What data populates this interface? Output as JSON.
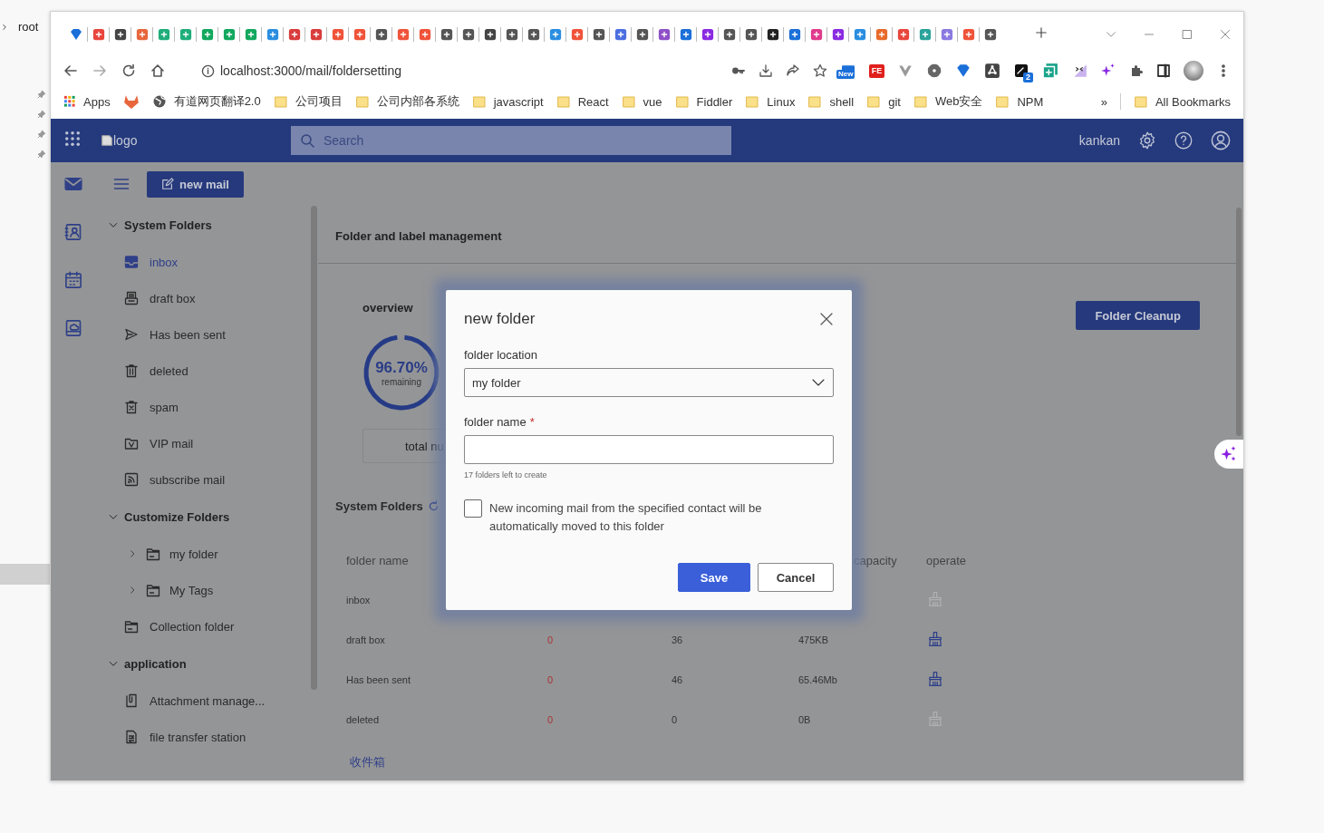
{
  "desktop": {
    "breadcrumb": "root"
  },
  "browser": {
    "url": "localhost:3000/mail/foldersetting",
    "extensions": [
      {
        "kind": "new",
        "label": "New"
      },
      {
        "kind": "fe",
        "label": "FE"
      },
      {
        "kind": "vee"
      },
      {
        "kind": "gear"
      },
      {
        "kind": "diamond"
      },
      {
        "kind": "graph"
      },
      {
        "kind": "translate",
        "label": "2"
      },
      {
        "kind": "copy"
      },
      {
        "kind": "code"
      },
      {
        "kind": "sparkle"
      }
    ],
    "bookmarks": [
      {
        "kind": "apps",
        "label": "Apps"
      },
      {
        "kind": "gitlab"
      },
      {
        "kind": "globe",
        "label": "有道网页翻译2.0"
      },
      {
        "kind": "folder",
        "label": "公司项目"
      },
      {
        "kind": "folder",
        "label": "公司内部各系统"
      },
      {
        "kind": "folder",
        "label": "javascript"
      },
      {
        "kind": "folder",
        "label": "React"
      },
      {
        "kind": "folder",
        "label": "vue"
      },
      {
        "kind": "folder",
        "label": "Fiddler"
      },
      {
        "kind": "folder",
        "label": "Linux"
      },
      {
        "kind": "folder",
        "label": "shell"
      },
      {
        "kind": "folder",
        "label": "git"
      },
      {
        "kind": "folder",
        "label": "Web安全"
      },
      {
        "kind": "folder",
        "label": "NPM"
      }
    ],
    "bookmarks_overflow": "»",
    "all_bookmarks": "All Bookmarks"
  },
  "app": {
    "logo": "logo",
    "search_placeholder": "Search",
    "user": "kankan",
    "rail": [
      {
        "kind": "mail",
        "selected": true
      },
      {
        "kind": "contacts",
        "selected": false
      },
      {
        "kind": "calendar",
        "selected": false
      },
      {
        "kind": "disk",
        "selected": false
      }
    ],
    "new_mail": "new mail",
    "sidebar": [
      {
        "title": "System Folders",
        "expanded": true,
        "items": [
          {
            "label": "inbox",
            "kind": "inbox",
            "selected": true
          },
          {
            "label": "draft box",
            "kind": "draft",
            "selected": false
          },
          {
            "label": "Has been sent",
            "kind": "send",
            "selected": false
          },
          {
            "label": "deleted",
            "kind": "trash",
            "selected": false
          },
          {
            "label": "spam",
            "kind": "spam",
            "selected": false
          },
          {
            "label": "VIP mail",
            "kind": "vip",
            "selected": false
          },
          {
            "label": "subscribe mail",
            "kind": "rss",
            "selected": false
          }
        ]
      },
      {
        "title": "Customize Folders",
        "expanded": true,
        "items": [
          {
            "label": "my folder",
            "kind": "folder",
            "selected": false,
            "expanded": false
          },
          {
            "label": "My Tags",
            "kind": "folder",
            "selected": false,
            "expanded": false
          },
          {
            "label": "Collection folder",
            "kind": "folder",
            "selected": false
          }
        ]
      },
      {
        "title": "application",
        "expanded": true,
        "items": [
          {
            "label": "Attachment manage...",
            "kind": "clip",
            "selected": false
          },
          {
            "label": "file transfer station",
            "kind": "file",
            "selected": false
          }
        ]
      }
    ],
    "page_title": "Folder and label management",
    "overview": {
      "title": "overview",
      "percent": "96.70%",
      "caption": "remaining",
      "level": 0.967,
      "total_label": "total nu"
    },
    "cleanup_button": "Folder Cleanup",
    "table": {
      "title": "System Folders",
      "columns": [
        "folder name",
        "capacity",
        "operate"
      ],
      "rows": [
        {
          "name": "inbox",
          "disabled": true
        },
        {
          "name": "draft box",
          "column_2": "0",
          "column_3": "36",
          "capacity": "475KB",
          "disabled": false
        },
        {
          "name": "Has been sent",
          "column_2": "0",
          "column_3": "46",
          "capacity": "65.46Mb",
          "disabled": false
        },
        {
          "name": "deleted",
          "column_2": "0",
          "column_3": "0",
          "capacity": "0B",
          "disabled": true
        }
      ]
    },
    "link": "收件箱"
  },
  "dialog": {
    "title": "new folder",
    "location_label": "folder location",
    "location_value": "my folder",
    "name_label": "folder name",
    "required_mark": "*",
    "hint": "17 folders left to create",
    "auto_move": {
      "label": "New incoming mail from the specified contact will be automatically moved to this folder",
      "checked": false
    },
    "buttons": [
      {
        "label": "Save",
        "kind": "primary"
      },
      {
        "label": "Cancel",
        "kind": "secondary"
      }
    ]
  }
}
